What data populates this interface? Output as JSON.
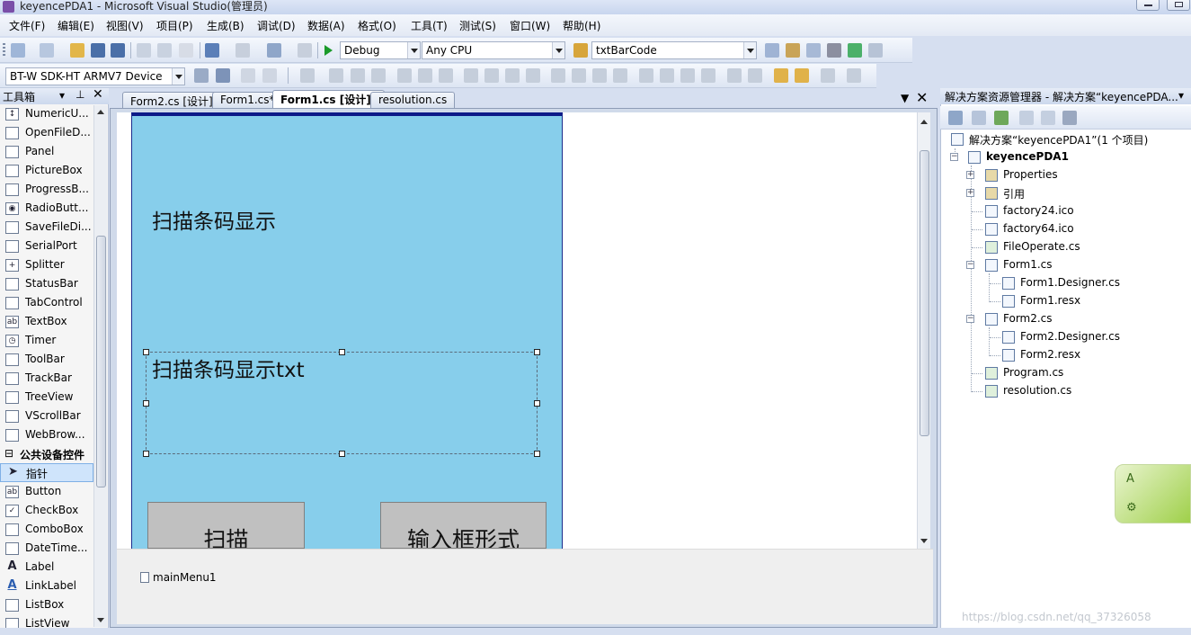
{
  "window": {
    "title": "keyencePDA1 - Microsoft Visual Studio(管理员)"
  },
  "menu": [
    "文件(F)",
    "编辑(E)",
    "视图(V)",
    "项目(P)",
    "生成(B)",
    "调试(D)",
    "数据(A)",
    "格式(O)",
    "工具(T)",
    "测试(S)",
    "窗口(W)",
    "帮助(H)"
  ],
  "toolbar": {
    "config": "Debug",
    "platform": "Any CPU",
    "find": "txtBarCode",
    "device": "BT-W SDK-HT ARMV7 Device"
  },
  "toolbox": {
    "title": "工具箱",
    "items_top": [
      "NumericU...",
      "OpenFileD...",
      "Panel",
      "PictureBox",
      "ProgressB...",
      "RadioButt...",
      "SaveFileDi...",
      "SerialPort",
      "Splitter",
      "StatusBar",
      "TabControl",
      "TextBox",
      "Timer",
      "ToolBar",
      "TrackBar",
      "TreeView",
      "VScrollBar",
      "WebBrow..."
    ],
    "category": "公共设备控件",
    "items_bottom": [
      "指针",
      "Button",
      "CheckBox",
      "ComboBox",
      "DateTime...",
      "Label",
      "LinkLabel",
      "ListBox",
      "ListView"
    ]
  },
  "tabs": [
    "Form2.cs [设计]",
    "Form1.cs*",
    "Form1.cs [设计]*",
    "resolution.cs"
  ],
  "designer": {
    "label1": "扫描条码显示",
    "textbox": "扫描条码显示txt",
    "button_scan": "扫描",
    "button_input": "输入框形式",
    "tray_item": "mainMenu1"
  },
  "solution_explorer": {
    "title": "解决方案资源管理器 - 解决方案“keyencePDA...",
    "solution": "解决方案“keyencePDA1”(1 个项目)",
    "project": "keyencePDA1",
    "nodes": [
      "Properties",
      "引用",
      "factory24.ico",
      "factory64.ico",
      "FileOperate.cs",
      "Form1.cs",
      "Form1.Designer.cs",
      "Form1.resx",
      "Form2.cs",
      "Form2.Designer.cs",
      "Form2.resx",
      "Program.cs",
      "resolution.cs"
    ]
  },
  "watermark": "https://blog.csdn.net/qq_37326058"
}
